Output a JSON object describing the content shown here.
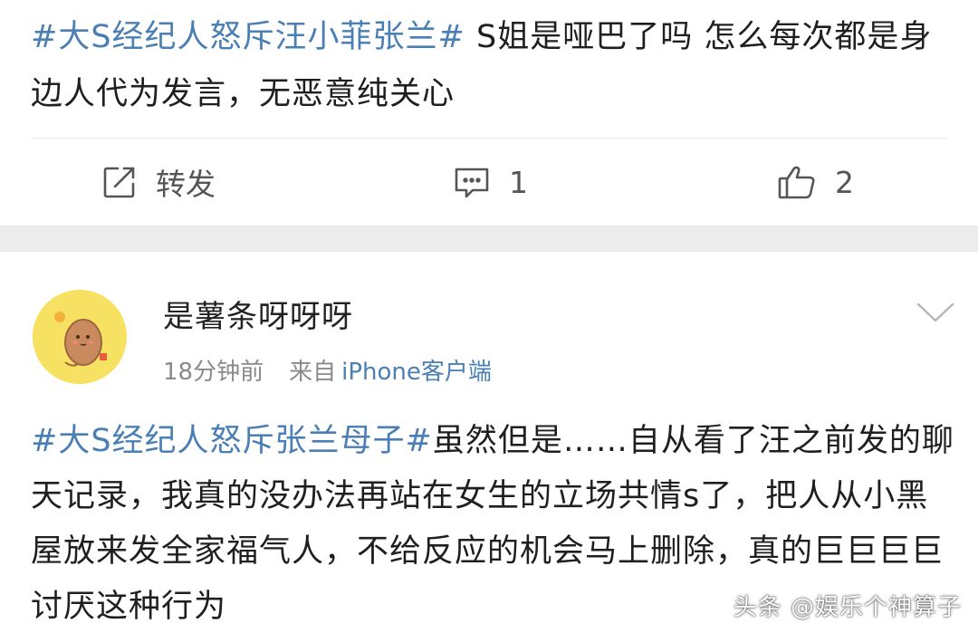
{
  "post1": {
    "tag": "#大S经纪人怒斥汪小菲张兰#",
    "body": " S姐是哑巴了吗 怎么每次都是身边人代为发言，无恶意纯关心"
  },
  "actions": {
    "repost_label": "转发",
    "comment_count": "1",
    "like_count": "2"
  },
  "post2": {
    "username": "是薯条呀呀呀",
    "time": "18分钟前",
    "source_label": "来自",
    "source_link": "iPhone客户端",
    "tag": "#大S经纪人怒斥张兰母子#",
    "body": "虽然但是……自从看了汪之前发的聊天记录，我真的没办法再站在女生的立场共情s了，把人从小黑屋放来发全家福气人，不给反应的机会马上删除，真的巨巨巨巨讨厌这种行为"
  },
  "watermark": "头条 @娱乐个神算子",
  "colors": {
    "link": "#4a7fb5",
    "text": "#1f1f1f",
    "muted": "#8a8a8a",
    "separator": "#ececec",
    "avatar_bg": "#f7e163"
  },
  "icons": {
    "repost": "share-edit-icon",
    "comment": "comment-bubble-icon",
    "like": "thumbs-up-icon",
    "menu": "chevron-down-icon"
  }
}
